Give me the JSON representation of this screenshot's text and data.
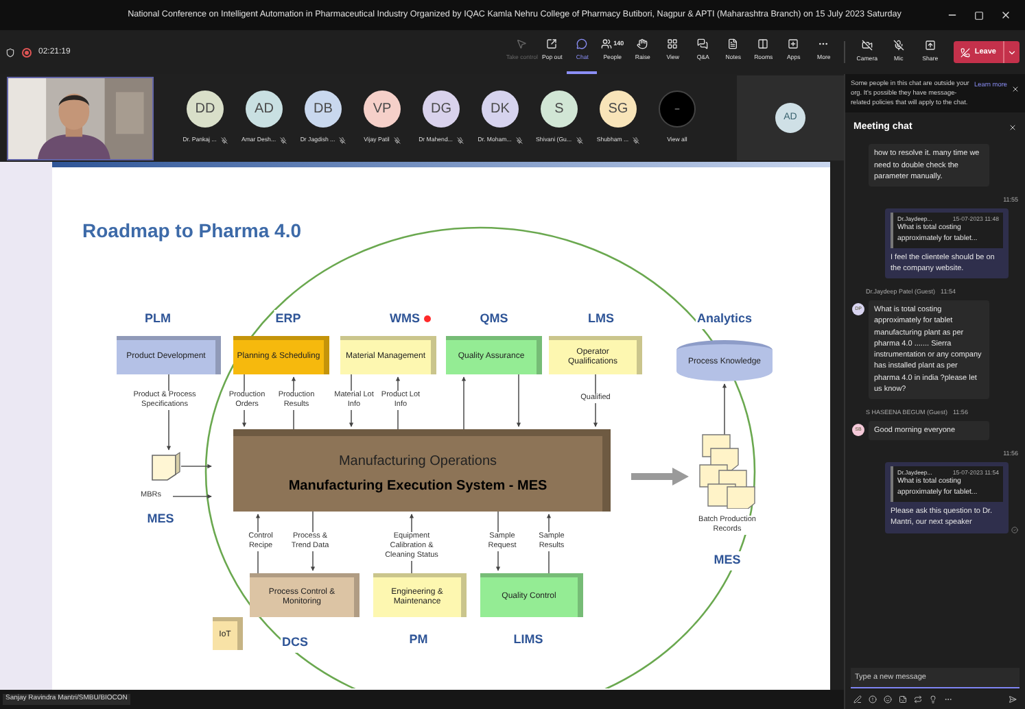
{
  "window": {
    "title": "National Conference on Intelligent Automation in Pharmaceutical Industry Organized by IQAC Kamla Nehru College of Pharmacy Butibori, Nagpur & APTI (Maharashtra Branch) on 15 July 2023 Saturday"
  },
  "toolbar": {
    "recording_time": "02:21:19",
    "buttons": [
      {
        "label": "Take control",
        "disabled": true,
        "selected": false
      },
      {
        "label": "Pop out",
        "disabled": false,
        "selected": false
      },
      {
        "label": "Chat",
        "disabled": false,
        "selected": true
      },
      {
        "label": "People",
        "count": "140",
        "disabled": false,
        "selected": false
      },
      {
        "label": "Raise",
        "disabled": false,
        "selected": false
      },
      {
        "label": "View",
        "disabled": false,
        "selected": false
      },
      {
        "label": "Q&A",
        "disabled": false,
        "selected": false
      },
      {
        "label": "Notes",
        "disabled": false,
        "selected": false
      },
      {
        "label": "Rooms",
        "disabled": false,
        "selected": false
      },
      {
        "label": "Apps",
        "disabled": false,
        "selected": false
      },
      {
        "label": "More",
        "disabled": false,
        "selected": false
      }
    ],
    "devices": [
      {
        "label": "Camera",
        "on": false
      },
      {
        "label": "Mic",
        "on": false
      },
      {
        "label": "Share"
      }
    ],
    "leave": "Leave"
  },
  "participants": [
    {
      "initials": "DD",
      "name": "Dr. Pankaj ...",
      "color": "#d9dfc9",
      "muted": true
    },
    {
      "initials": "AD",
      "name": "Amar Desh...",
      "color": "#c9e0e2",
      "muted": true
    },
    {
      "initials": "DB",
      "name": "Dr Jagdish ...",
      "color": "#c9d8ee",
      "muted": true
    },
    {
      "initials": "VP",
      "name": "Vijay Patil",
      "color": "#f5d0c9",
      "muted": true
    },
    {
      "initials": "DG",
      "name": "Dr Mahend...",
      "color": "#d9d2ec",
      "muted": true
    },
    {
      "initials": "DK",
      "name": "Dr. Moham...",
      "color": "#d6d3ee",
      "muted": true
    },
    {
      "initials": "S",
      "name": "Shivani (Gu...",
      "color": "#d1e6d5",
      "muted": true
    },
    {
      "initials": "SG",
      "name": "Shubham ...",
      "color": "#f8e4b9",
      "muted": true
    }
  ],
  "view_all": {
    "label": "View all"
  },
  "spotlight": {
    "initials": "AD"
  },
  "presenter": "Sanjay Ravindra Mantri/SMBU/BIOCON",
  "slide": {
    "title": "Roadmap to Pharma 4.0",
    "headers": [
      "PLM",
      "ERP",
      "WMS",
      "QMS",
      "LMS",
      "Analytics",
      "MES",
      "MES",
      "DCS",
      "PM",
      "LIMS"
    ],
    "nodes": [
      {
        "kind": "box",
        "label": "Product Development",
        "color": "#b4c1e6"
      },
      {
        "kind": "box",
        "label": "Planning & Scheduling",
        "color": "#f6b90d"
      },
      {
        "kind": "box",
        "label": "Material Management",
        "color": "#fdf7b0"
      },
      {
        "kind": "box",
        "label": "Quality Assurance",
        "color": "#94ec94"
      },
      {
        "kind": "box",
        "label": "Operator Qualifications",
        "color": "#fdf7b0"
      },
      {
        "kind": "cylinder",
        "label": "Process Knowledge",
        "color": "#b4c1e6"
      },
      {
        "kind": "block",
        "label": "Manufacturing Operations",
        "sublabel": "Manufacturing Execution System - MES",
        "color": "#8d7457"
      },
      {
        "kind": "box",
        "label": "Process Control & Monitoring",
        "color": "#dcc4a4"
      },
      {
        "kind": "box",
        "label": "Engineering & Maintenance",
        "color": "#fdf7b0"
      },
      {
        "kind": "box",
        "label": "Quality Control",
        "color": "#94ec94"
      },
      {
        "kind": "box",
        "label": "IoT",
        "color": "#f8e2a6"
      }
    ],
    "labels": [
      "Product & Process Specifications",
      "Production Orders",
      "Production Results",
      "Material Lot Info",
      "Product Lot Info",
      "Qualified",
      "MBRs",
      "Batch Production Records",
      "Control Recipe",
      "Process & Trend Data",
      "Equipment Calibration & Cleaning Status",
      "Sample Request",
      "Sample Results"
    ]
  },
  "chat": {
    "notice": "Some people in this chat are outside your org. It's possible they have message-related policies that will apply to the chat.",
    "notice_link": "Learn more",
    "title": "Meeting chat",
    "messages": [
      {
        "kind": "received",
        "text": "how to resolve it. many time we need to double check the parameter manually."
      },
      {
        "kind": "sent",
        "time": "11:55",
        "quote": {
          "author": "Dr.Jaydeep...",
          "time": "15-07-2023 11:48",
          "text": "What is total costing approximately for tablet..."
        },
        "text": "I feel the clientele should be on the company website.",
        "seen": false
      },
      {
        "kind": "received",
        "author": "Dr.Jaydeep Patel (Guest)",
        "time": "11:54",
        "initials": "DP",
        "color": "#d8d4f0",
        "text": "What is total costing approximately for tablet manufacturing plant as per pharma 4.0 ....... Sierra instrumentation or any company has installed plant as per pharma 4.0 in india ?please let us know?"
      },
      {
        "kind": "received",
        "author": "S HASEENA BEGUM (Guest)",
        "time": "11:56",
        "initials": "SB",
        "color": "#f4c9d9",
        "text": "Good morning everyone"
      },
      {
        "kind": "sent",
        "time": "11:56",
        "quote": {
          "author": "Dr.Jaydeep...",
          "time": "15-07-2023 11:54",
          "text": "What is total costing approximately for tablet..."
        },
        "text": "Please ask this question to Dr. Mantri, our next speaker",
        "seen": true
      }
    ],
    "compose": {
      "placeholder": "Type a new message"
    }
  }
}
